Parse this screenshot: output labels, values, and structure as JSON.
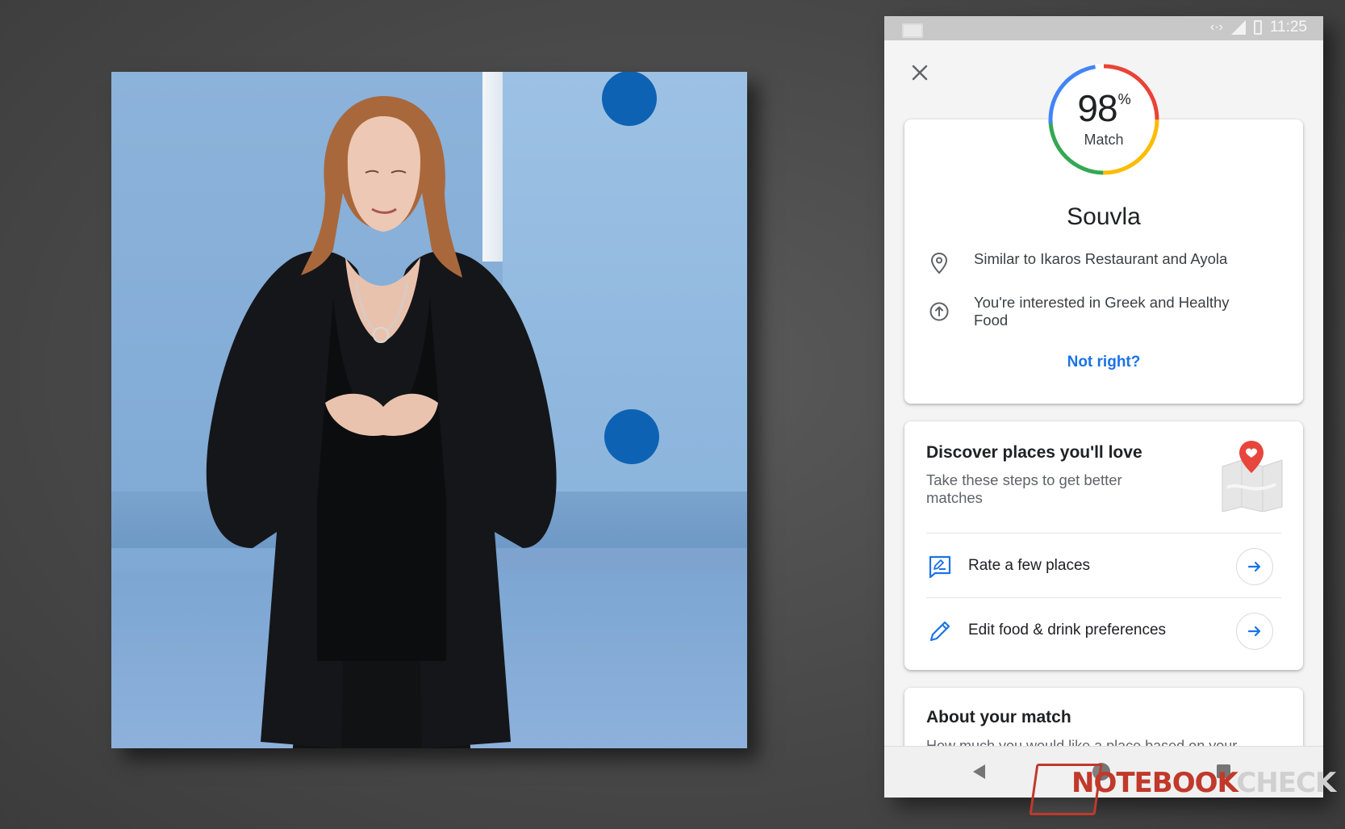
{
  "status_bar": {
    "time": "11:25"
  },
  "match": {
    "percent": "98",
    "percent_sign": "%",
    "label": "Match",
    "percent_value": 0.98
  },
  "place": {
    "name": "Souvla",
    "reasons": [
      {
        "icon": "location-pin-icon",
        "text": "Similar to Ikaros Restaurant and Ayola"
      },
      {
        "icon": "arrow-up-circle-icon",
        "text": "You're interested in Greek and Healthy Food"
      }
    ],
    "not_right_label": "Not right?"
  },
  "discover": {
    "title": "Discover places you'll love",
    "subtitle": "Take these steps to get better matches",
    "actions": [
      {
        "icon": "rate-review-icon",
        "label": "Rate a few places"
      },
      {
        "icon": "pencil-icon",
        "label": "Edit food & drink preferences"
      }
    ]
  },
  "about": {
    "title": "About your match",
    "subtitle": "How much you would like a place based on your"
  },
  "watermark": {
    "part1": "NOTEBOOK",
    "part2": "CHECK"
  },
  "colors": {
    "accent": "#1a73e8",
    "ring_blue": "#4285f4",
    "ring_red": "#ea4335",
    "ring_yellow": "#fbbc04",
    "ring_green": "#34a853",
    "pin_red": "#e8453c"
  }
}
